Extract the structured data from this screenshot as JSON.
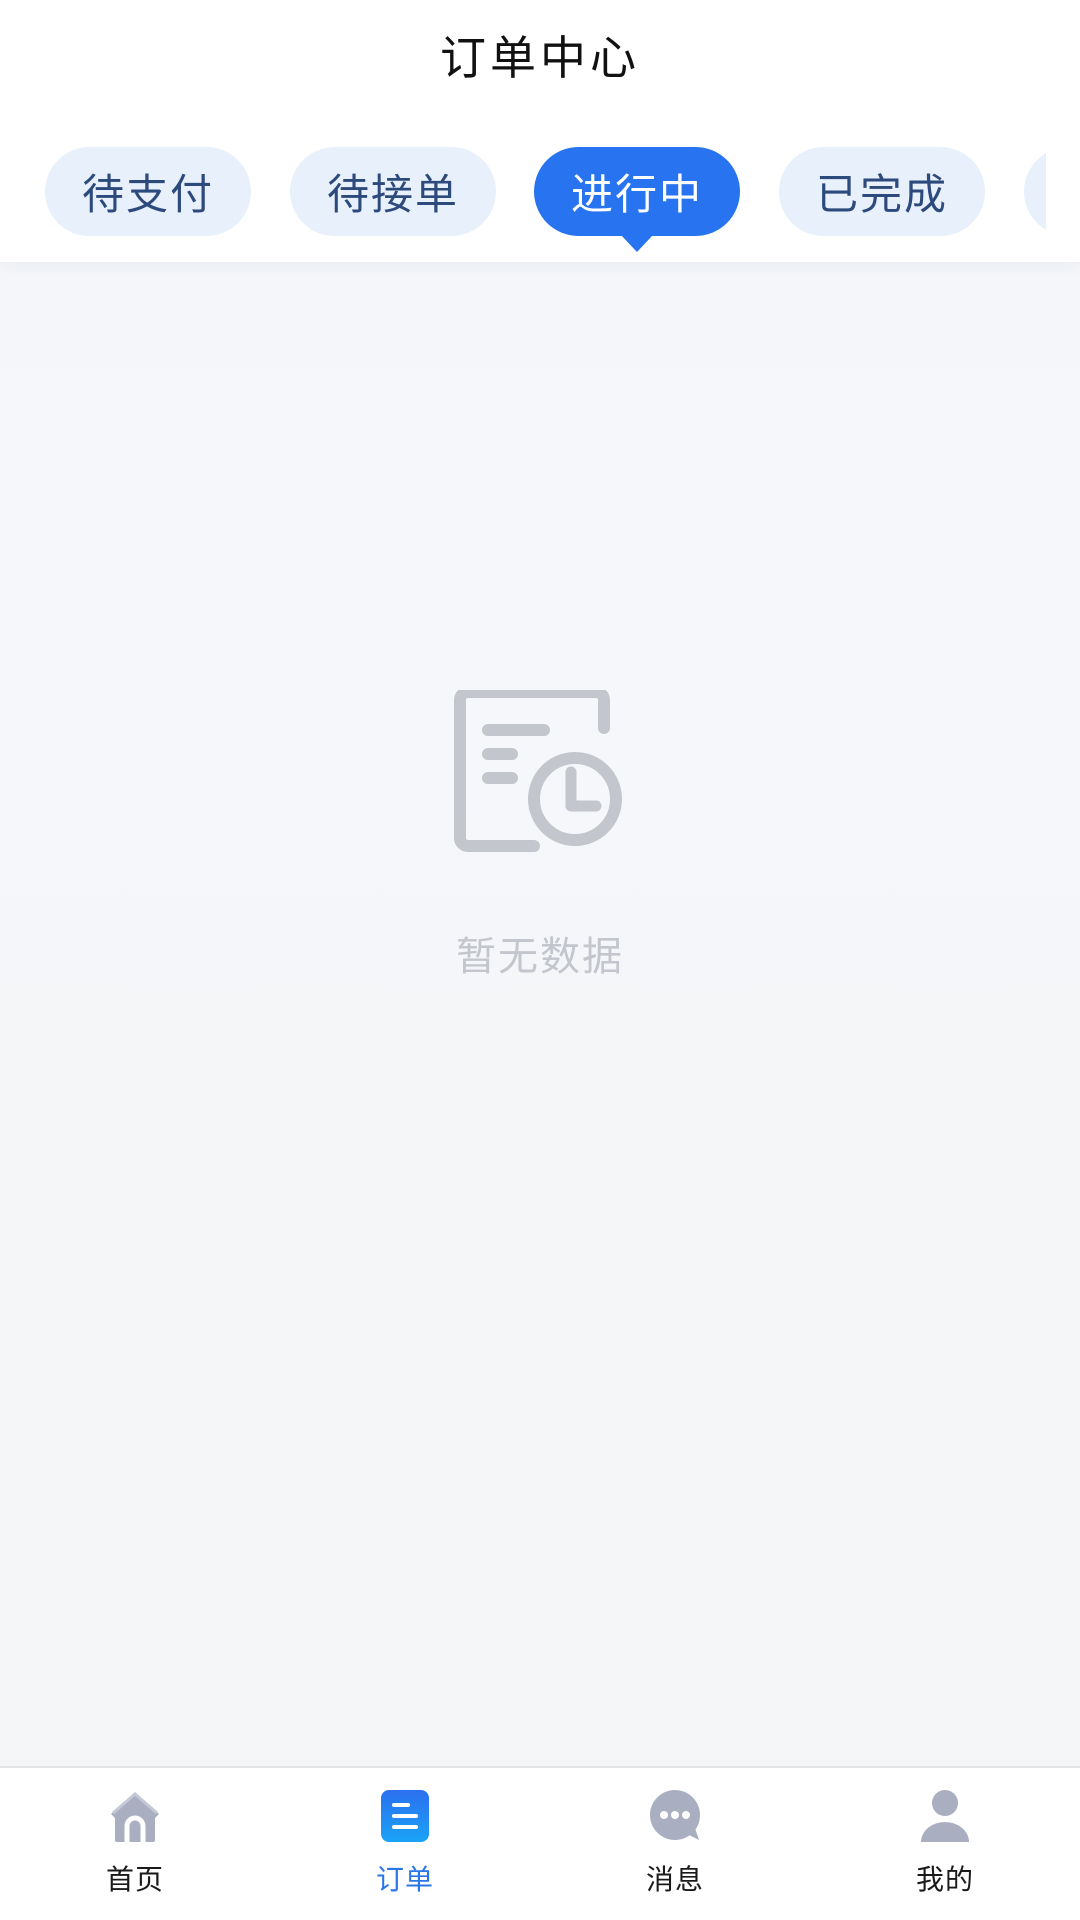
{
  "header": {
    "title": "订单中心"
  },
  "tabs": [
    {
      "label": "待支付",
      "active": false
    },
    {
      "label": "待接单",
      "active": false
    },
    {
      "label": "进行中",
      "active": true
    },
    {
      "label": "已完成",
      "active": false
    },
    {
      "label": "",
      "active": false
    }
  ],
  "empty_state": {
    "icon": "document-clock-icon",
    "text": "暂无数据"
  },
  "bottom_nav": {
    "items": [
      {
        "label": "首页",
        "icon": "home-icon",
        "active": false
      },
      {
        "label": "订单",
        "icon": "order-list-icon",
        "active": true
      },
      {
        "label": "消息",
        "icon": "chat-bubble-icon",
        "active": false
      },
      {
        "label": "我的",
        "icon": "user-icon",
        "active": false
      }
    ]
  },
  "colors": {
    "accent": "#2873f0",
    "tab_bg": "#e8f0fc",
    "tab_text": "#2d4a7c",
    "empty_gray": "#c3c6cd",
    "nav_icon_gray": "#a9aec1"
  }
}
